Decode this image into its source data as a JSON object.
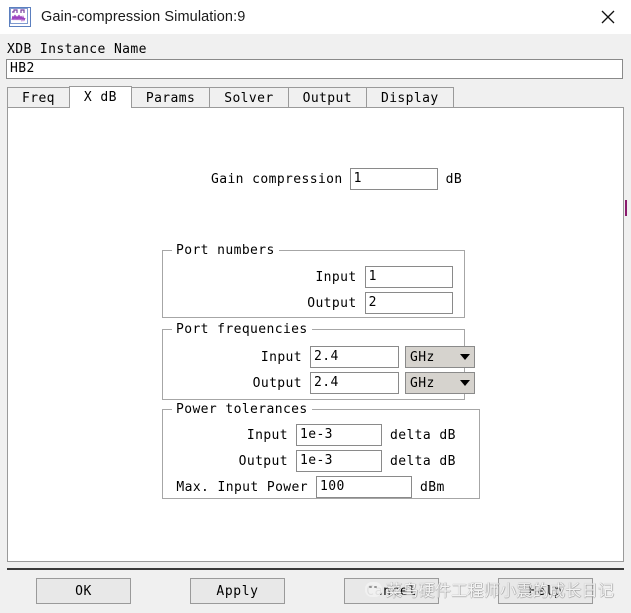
{
  "window": {
    "title": "Gain-compression Simulation:9",
    "icon": "waveform-icon",
    "close_label": "✕"
  },
  "instance": {
    "label": "XDB Instance Name",
    "value": "HB2"
  },
  "tabs": [
    {
      "label": "Freq",
      "active": false
    },
    {
      "label": "X dB",
      "active": true
    },
    {
      "label": "Params",
      "active": false
    },
    {
      "label": "Solver",
      "active": false
    },
    {
      "label": "Output",
      "active": false
    },
    {
      "label": "Display",
      "active": false
    }
  ],
  "gain_compression": {
    "label": "Gain compression",
    "value": "1",
    "unit": "dB"
  },
  "port_numbers": {
    "title": "Port numbers",
    "input_label": "Input",
    "input_value": "1",
    "output_label": "Output",
    "output_value": "2"
  },
  "port_frequencies": {
    "title": "Port frequencies",
    "input_label": "Input",
    "input_value": "2.4",
    "input_unit": "GHz",
    "output_label": "Output",
    "output_value": "2.4",
    "output_unit": "GHz"
  },
  "power_tolerances": {
    "title": "Power tolerances",
    "input_label": "Input",
    "input_value": "1e-3",
    "input_suffix": "delta dB",
    "output_label": "Output",
    "output_value": "1e-3",
    "output_suffix": "delta dB",
    "max_label": "Max. Input Power",
    "max_value": "100",
    "max_suffix": "dBm"
  },
  "buttons": {
    "ok": "OK",
    "apply": "Apply",
    "cancel": "Cancel",
    "help": "Help"
  },
  "watermark": {
    "text": "菜鸟硬件工程师小震的成长日记",
    "logo": "wechat-icon"
  },
  "colors": {
    "window_bg": "#f0f0f0",
    "panel_bg": "#ffffff",
    "border": "#9a9a9a",
    "dropdown_bg": "#d6d3ce",
    "button_bg": "#e8e8e8"
  }
}
